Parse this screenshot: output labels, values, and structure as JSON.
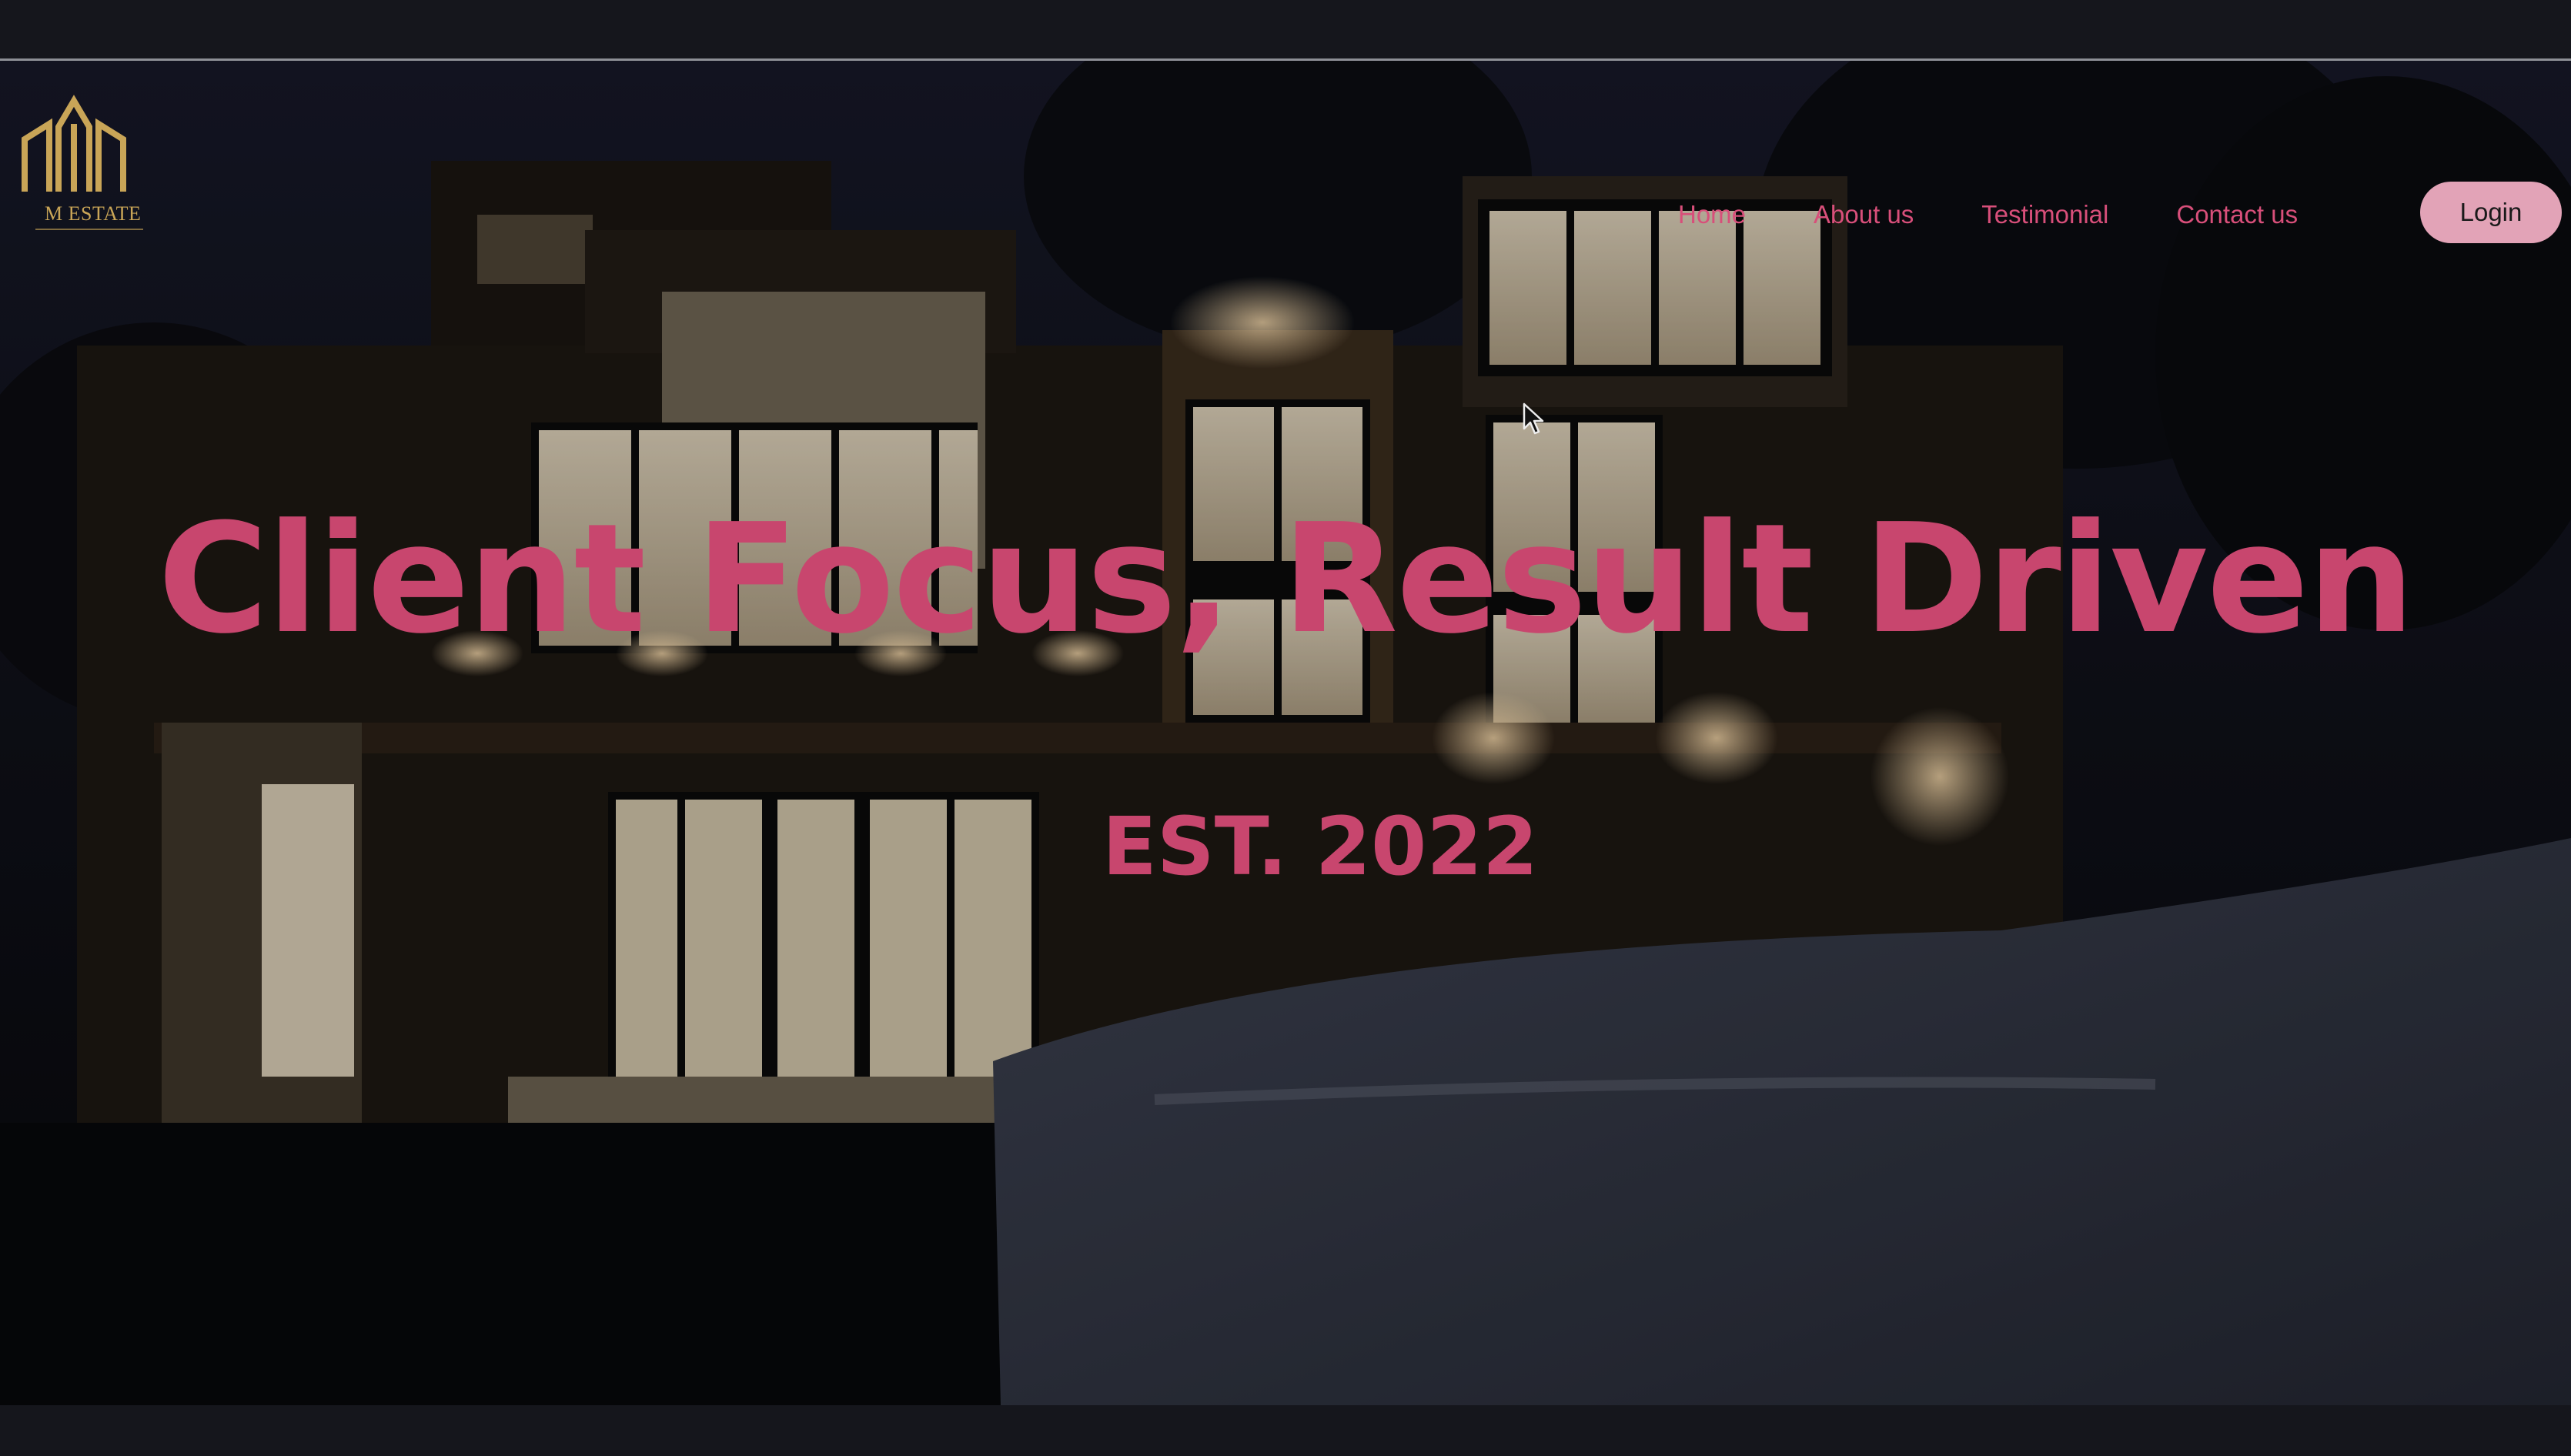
{
  "brand": {
    "logo_icon": "building-logo-icon",
    "name": "M ESTATE",
    "accent_color": "#c9a557"
  },
  "nav": {
    "items": [
      {
        "label": "Home"
      },
      {
        "label": "About us"
      },
      {
        "label": "Testimonial"
      },
      {
        "label": "Contact us"
      }
    ],
    "link_color": "#d84f7a",
    "login_label": "Login",
    "login_bg": "#e2a3b7"
  },
  "hero": {
    "headline": "Client Focus, Result Driven",
    "subheadline": "EST. 2022",
    "text_color": "#c8466e",
    "background": "night-modern-house-photo"
  },
  "cursor_icon": "mouse-pointer-icon"
}
